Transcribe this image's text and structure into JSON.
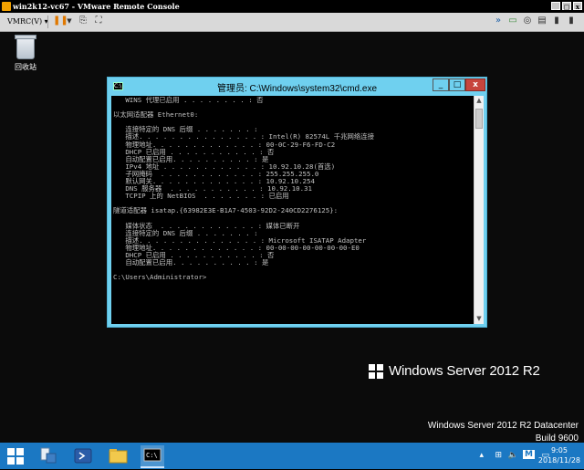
{
  "vmrc": {
    "title": "win2k12-vc67 - VMware Remote Console",
    "menu_label": "VMRC(V) ▾"
  },
  "desktop": {
    "recycle_bin_label": "回收站"
  },
  "cmd": {
    "title": "管理员: C:\\Windows\\system32\\cmd.exe",
    "lines": [
      "   WINS 代理已启用 . . . . . . . . : 否",
      "",
      "以太网适配器 Ethernet0:",
      "",
      "   连接特定的 DNS 后缀 . . . . . . . :",
      "   描述. . . . . . . . . . . . . . . : Intel(R) 82574L 千兆网络连接",
      "   物理地址. . . . . . . . . . . . . : 00-0C-29-F6-FD-C2",
      "   DHCP 已启用 . . . . . . . . . . . : 否",
      "   自动配置已启用. . . . . . . . . . : 是",
      "   IPv4 地址 . . . . . . . . . . . . : 10.92.10.28(首选)",
      "   子网掩码  . . . . . . . . . . . . : 255.255.255.0",
      "   默认网关. . . . . . . . . . . . . : 10.92.10.254",
      "   DNS 服务器  . . . . . . . . . . . : 10.92.10.31",
      "   TCPIP 上的 NetBIOS  . . . . . . . : 已启用",
      "",
      "隧道适配器 isatap.{63982E3E-B1A7-4503-92D2-240CD2276125}:",
      "",
      "   媒体状态  . . . . . . . . . . . . : 媒体已断开",
      "   连接特定的 DNS 后缀 . . . . . . . :",
      "   描述. . . . . . . . . . . . . . . : Microsoft ISATAP Adapter",
      "   物理地址. . . . . . . . . . . . . : 00-00-00-00-00-00-00-E0",
      "   DHCP 已启用 . . . . . . . . . . . : 否",
      "   自动配置已启用. . . . . . . . . . : 是",
      "",
      "C:\\Users\\Administrator>"
    ]
  },
  "branding": {
    "windows_server": "Windows Server 2012 R2"
  },
  "edition": {
    "line1": "Windows Server 2012 R2 Datacenter",
    "line2": "Build 9600"
  },
  "taskbar": {
    "time": "9:05",
    "date": "2018/11/28",
    "ime": "M"
  },
  "colors": {
    "cmd_frame": "#6fd0ef",
    "taskbar": "#1b78c3",
    "close_button": "#c7453d"
  }
}
